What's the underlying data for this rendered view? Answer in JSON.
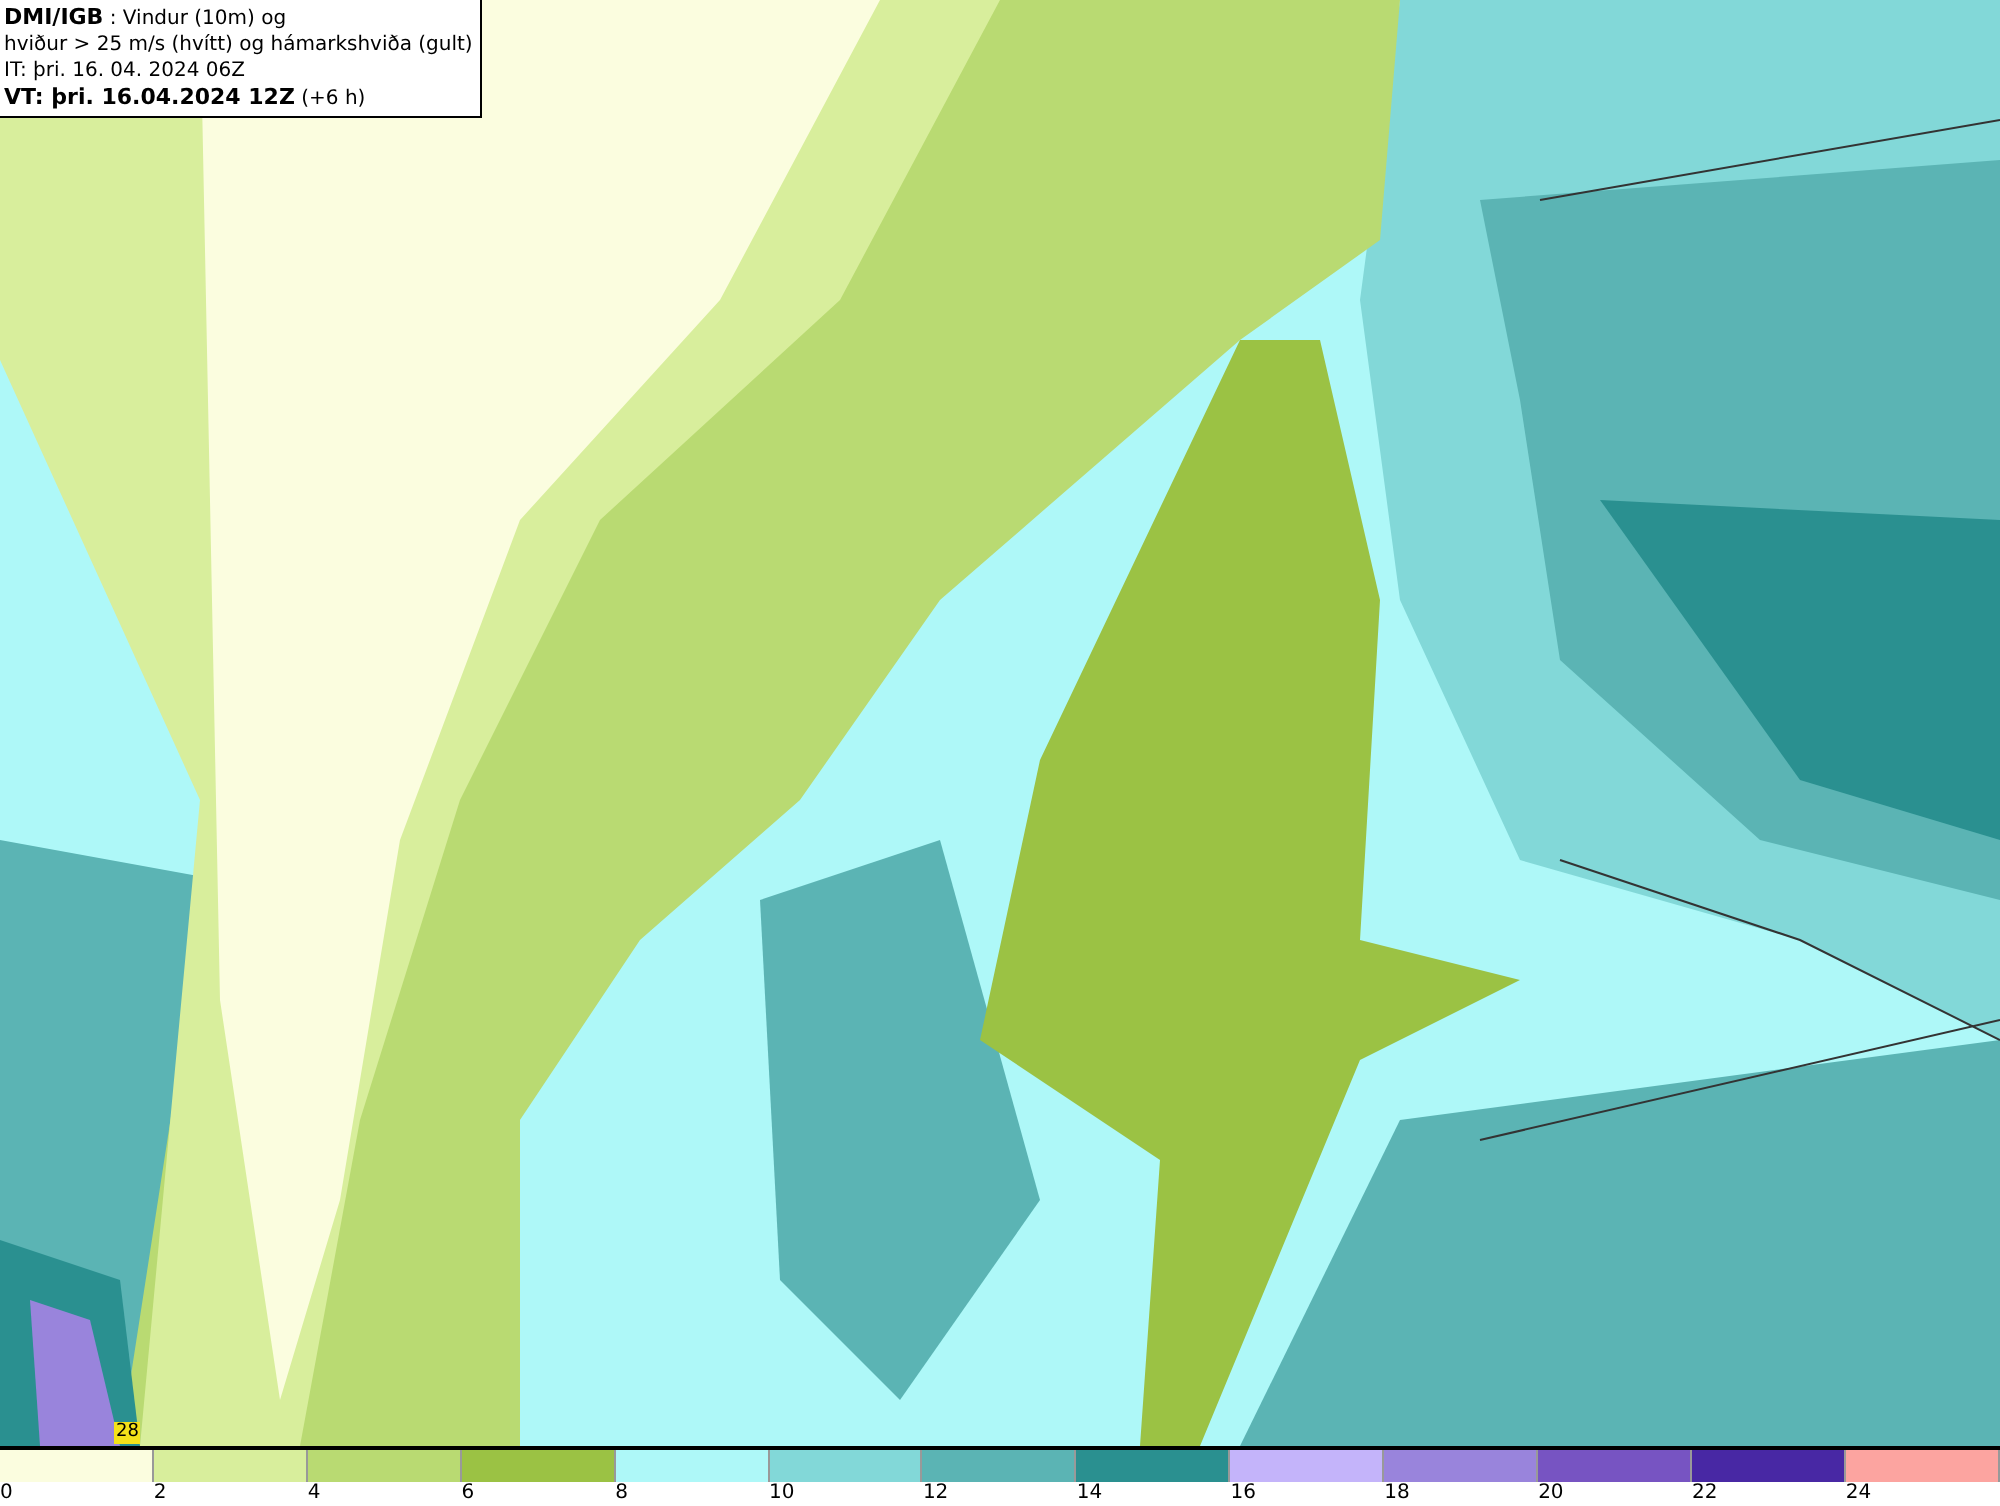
{
  "header": {
    "lines": [
      "**DMI/IGB** : Vindur (10m) og",
      "hviður > 25 m/s (hvítt) og hámarkshviða (gult)",
      "IT: þri. 16. 04. 2024 06Z",
      "**VT: þri. 16.04.2024 12Z** (+6 h)"
    ]
  },
  "map": {
    "gust_label": "28"
  },
  "legend": [
    {
      "label": "0",
      "color": "#fbfddf"
    },
    {
      "label": "2",
      "color": "#d8ee9c"
    },
    {
      "label": "4",
      "color": "#b9da72"
    },
    {
      "label": "6",
      "color": "#9bc244"
    },
    {
      "label": "8",
      "color": "#aef8f8"
    },
    {
      "label": "10",
      "color": "#82d8d8"
    },
    {
      "label": "12",
      "color": "#5bb4b4"
    },
    {
      "label": "14",
      "color": "#2a9090"
    },
    {
      "label": "16",
      "color": "#c4b4fa"
    },
    {
      "label": "18",
      "color": "#9984dc"
    },
    {
      "label": "20",
      "color": "#7754c2"
    },
    {
      "label": "22",
      "color": "#4828a4"
    },
    {
      "label": "24",
      "color": "#fca4a0"
    }
  ]
}
